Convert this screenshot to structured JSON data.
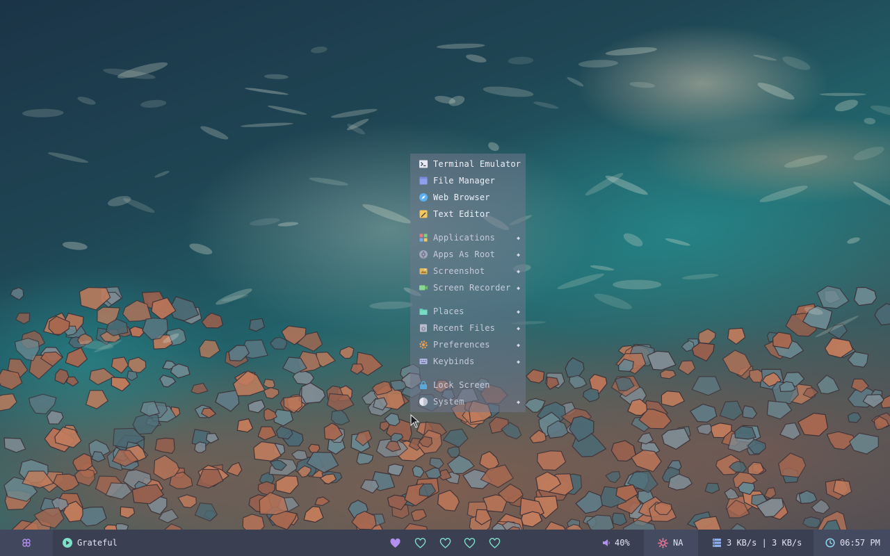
{
  "menu": {
    "groups": [
      [
        {
          "label": "Terminal Emulator",
          "icon": "terminal-icon",
          "submenu": false
        },
        {
          "label": "File Manager",
          "icon": "file-manager-icon",
          "submenu": false
        },
        {
          "label": "Web Browser",
          "icon": "web-browser-icon",
          "submenu": false
        },
        {
          "label": "Text Editor",
          "icon": "text-editor-icon",
          "submenu": false
        }
      ],
      [
        {
          "label": "Applications",
          "icon": "applications-icon",
          "submenu": true
        },
        {
          "label": "Apps As Root",
          "icon": "apps-as-root-icon",
          "submenu": true
        },
        {
          "label": "Screenshot",
          "icon": "screenshot-icon",
          "submenu": true
        },
        {
          "label": "Screen Recorder",
          "icon": "screen-recorder-icon",
          "submenu": true
        }
      ],
      [
        {
          "label": "Places",
          "icon": "places-icon",
          "submenu": true
        },
        {
          "label": "Recent Files",
          "icon": "recent-files-icon",
          "submenu": true
        },
        {
          "label": "Preferences",
          "icon": "preferences-icon",
          "submenu": true
        },
        {
          "label": "Keybinds",
          "icon": "keybinds-icon",
          "submenu": true
        }
      ],
      [
        {
          "label": "Lock Screen",
          "icon": "lock-screen-icon",
          "submenu": false
        },
        {
          "label": "System",
          "icon": "system-icon",
          "submenu": true
        }
      ]
    ],
    "submenu_arrow": "◆"
  },
  "bar": {
    "launcher_icon": "command-icon",
    "music": {
      "icon": "play-icon",
      "title": "Grateful"
    },
    "workspaces": {
      "count": 5,
      "active": 0,
      "icon": "heart-icon"
    },
    "volume": {
      "icon": "speaker-icon",
      "value": "40%"
    },
    "weather": {
      "icon": "sun-icon",
      "value": "NA"
    },
    "network": {
      "icon": "network-icon",
      "value": "3 KB/s | 3 KB/s"
    },
    "clock": {
      "icon": "clock-icon",
      "value": "06:57 PM"
    }
  },
  "colors": {
    "accent_purple": "#b48ef0",
    "accent_teal": "#7fe0c8",
    "accent_pink": "#f07898",
    "accent_blue": "#8fb0f0",
    "bar_bg": "#3a3f52"
  }
}
